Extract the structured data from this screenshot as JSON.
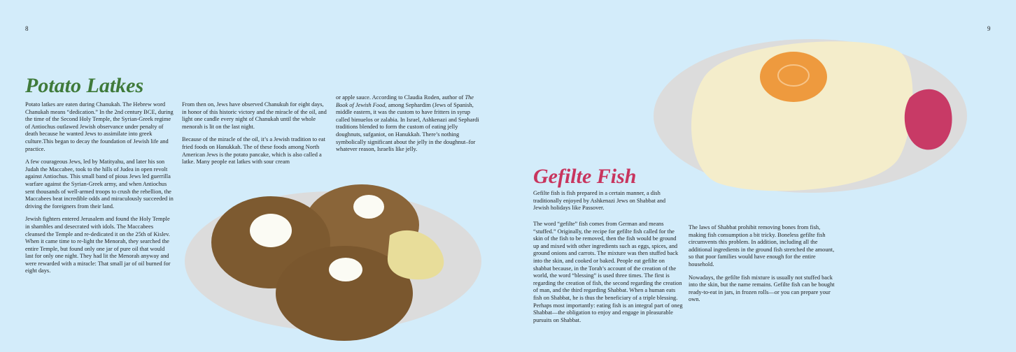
{
  "pages": {
    "left_number": "8",
    "right_number": "9"
  },
  "colors": {
    "latkes_title": "#3f7a3a",
    "gefilte_title": "#c8355e",
    "background": "#d3ecfa"
  },
  "latkes": {
    "title": "Potato Latkes",
    "col1": [
      "Potato latkes are eaten during Chanukah. The Hebrew word Chanukah means “dedication.” In the 2nd century BCE, during the time of the Second Holy Temple, the Syrian-Greek regime of Antiochus outlawed Jewish observance under penalty of death because he wanted Jews to assimilate into greek culture.This began to decay the foundation of Jewish life and practice.",
      "A few courageous Jews, led by Matityahu, and later his son Judah the Maccabee, took to the hills of Judea in open revolt against Antiochus. This small band of pious Jews led guerrilla warfare against the Syrian-Greek army, and when Antiochus sent thousands of well-armed troops to crush the rebellion, the Maccabees beat incredible odds and miraculously succeeded in driving the foreigners from their land.",
      "Jewish fighters entered Jerusalem and found the Holy Temple in shambles and desecrated with idols. The Maccabees cleansed the Temple and re-dedicated it on the 25th of Kislev. When it came time to re-light the Menorah, they searched the entire Temple, but found only one jar of pure oil that would last for only one night. They had lit the Menorah anyway and were rewarded with a miracle: That small jar of oil burned for eight days."
    ],
    "col2": [
      "From then on, Jews have observed Chanukuh for eight days, in honor of this historic victory and the miracle of the oil, and light one candle every night of Chanukah until the whole menorah is lit on the last night.",
      "Because of the miracle of the oil, it’s a Jewish tradition to eat fried foods on Hanukkah. The of these foods among North American Jews is the potato pancake, which is also called a latke.  Many people eat latkes with sour cream"
    ],
    "col3": {
      "p1_a": "or apple sauce. According to Claudia Roden, author of ",
      "p1_book": "The Book of Jewish Food",
      "p1_b": ", among Sephardim (Jews of Spanish, middle eastern, it was the custom to have fritters in syrup called bimuelos or zalabia. In Israel, Ashkenazi and Sephardi traditions blended to form the custom of eating jelly doughnuts, sufganiot, on Hanukkah. There’s nothing symbolically significant about the jelly in the doughnut–for whatever reason, Israelis like jelly."
    }
  },
  "gefilte": {
    "title": "Gefilte Fish",
    "intro": "Gefilte fish is fish prepared in a certain manner, a dish traditionally enjoyed by Ashkenazi Jews on Shabbat and Jewish holidays like Passover.",
    "col1": [
      "The word “gefilte” fish comes from German and means “stuffed.” Originally, the recipe for gefilte fish called for the skin of the fish to be removed, then the fish would be ground up and mixed with other ingredients such as eggs, spices, and ground onions and carrots. The mixture was then stuffed back into the skin, and cooked or baked. People eat gefilte on shabbat because, in the Torah’s account of the creation of the world, the word “blessing” is used three times. The first is regarding the creation of fish, the second regarding the creation of man, and the third regarding Shabbat. When a human eats fish on Shabbat, he is thus the beneficiary of a triple blessing. Perhaps most importantly: eating fish is an integral part of oneg Shabbat—the obligation to enjoy and engage in pleasurable pursuits on Shabbat."
    ],
    "col2": [
      "The laws of Shabbat prohibit removing bones from fish, making fish consumption a bit tricky. Boneless gefilte fish circumvents this problem. In addition, including all the additional ingredients in the ground fish stretched the amount, so that poor families would have enough for the entire household.",
      "Nowadays, the gefilte fish mixture is usually not stuffed back into the skin, but the name remains. Gefilte fish can be bought ready-to-eat in jars, in frozen rolls—or you can prepare your own."
    ]
  }
}
